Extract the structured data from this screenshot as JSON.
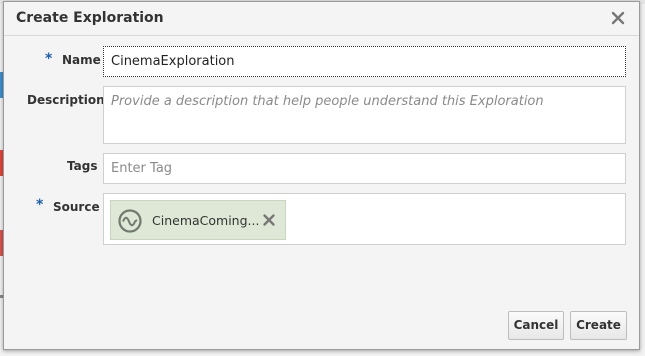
{
  "dialog": {
    "title": "Create Exploration"
  },
  "fields": {
    "name": {
      "label": "Name",
      "required_marker": "*",
      "value": "CinemaExploration"
    },
    "description": {
      "label": "Description",
      "placeholder": "Provide a description that help people understand this Exploration"
    },
    "tags": {
      "label": "Tags",
      "placeholder": "Enter Tag"
    },
    "source": {
      "label": "Source",
      "required_marker": "*",
      "chip_label": "CinemaComing...",
      "chip_icon": "data-source-icon"
    }
  },
  "footer": {
    "cancel_label": "Cancel",
    "create_label": "Create"
  },
  "colors": {
    "accent": "#1a5ea8",
    "chip_bg": "#dfe8d6"
  }
}
